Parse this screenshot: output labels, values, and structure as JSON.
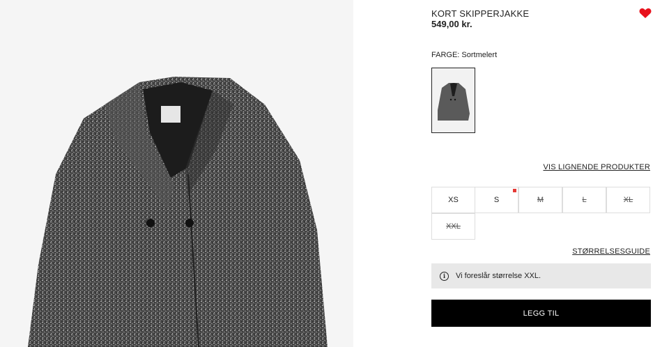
{
  "product": {
    "title": "KORT SKIPPERJAKKE",
    "price": "549,00 kr."
  },
  "icons": {
    "favorite": "heart-icon",
    "info": "info-icon"
  },
  "colors": {
    "accent": "#e8111c",
    "button_bg": "#000000",
    "notice_bg": "#e8e8e8",
    "low_stock": "#e53935"
  },
  "color_selector": {
    "label": "FARGE: Sortmelert",
    "selected_swatch": "Sortmelert"
  },
  "links": {
    "similar": "VIS LIGNENDE PRODUKTER",
    "size_guide": "STØRRELSESGUIDE"
  },
  "sizes": [
    {
      "label": "XS",
      "available": true,
      "low_stock": false
    },
    {
      "label": "S",
      "available": true,
      "low_stock": true
    },
    {
      "label": "M",
      "available": false,
      "low_stock": false
    },
    {
      "label": "L",
      "available": false,
      "low_stock": false
    },
    {
      "label": "XL",
      "available": false,
      "low_stock": false
    },
    {
      "label": "XXL",
      "available": false,
      "low_stock": false
    }
  ],
  "suggestion": {
    "info_glyph": "i",
    "text": "Vi foreslår størrelse XXL."
  },
  "cart": {
    "add_label": "LEGG TIL"
  }
}
